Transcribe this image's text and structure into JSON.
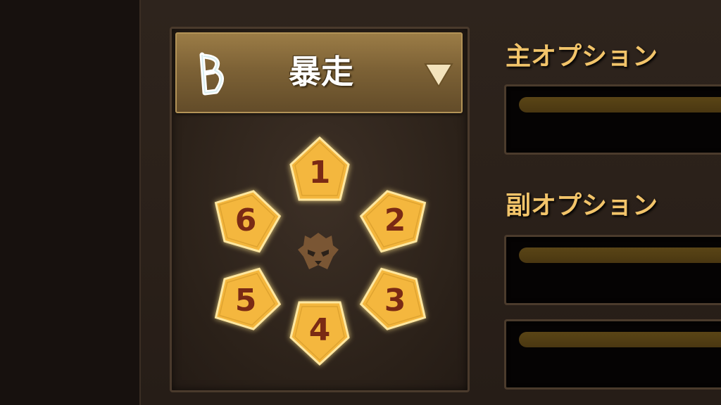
{
  "rune_set": {
    "name": "暴走",
    "icon": "violent-rune-icon",
    "dropdown_icon": "triangle-down-icon"
  },
  "slots": [
    {
      "label": "1"
    },
    {
      "label": "2"
    },
    {
      "label": "3"
    },
    {
      "label": "4"
    },
    {
      "label": "5"
    },
    {
      "label": "6"
    }
  ],
  "center_icon": "monster-mask-icon",
  "main_option": {
    "title": "主オプション"
  },
  "sub_option": {
    "title": "副オプション"
  },
  "colors": {
    "slot_fill": "#f4b73e",
    "slot_glow": "#ffe58a",
    "slot_text": "#7a2a14",
    "title_gold": "#f2c46a",
    "dropdown_brown": "#7d6236"
  }
}
